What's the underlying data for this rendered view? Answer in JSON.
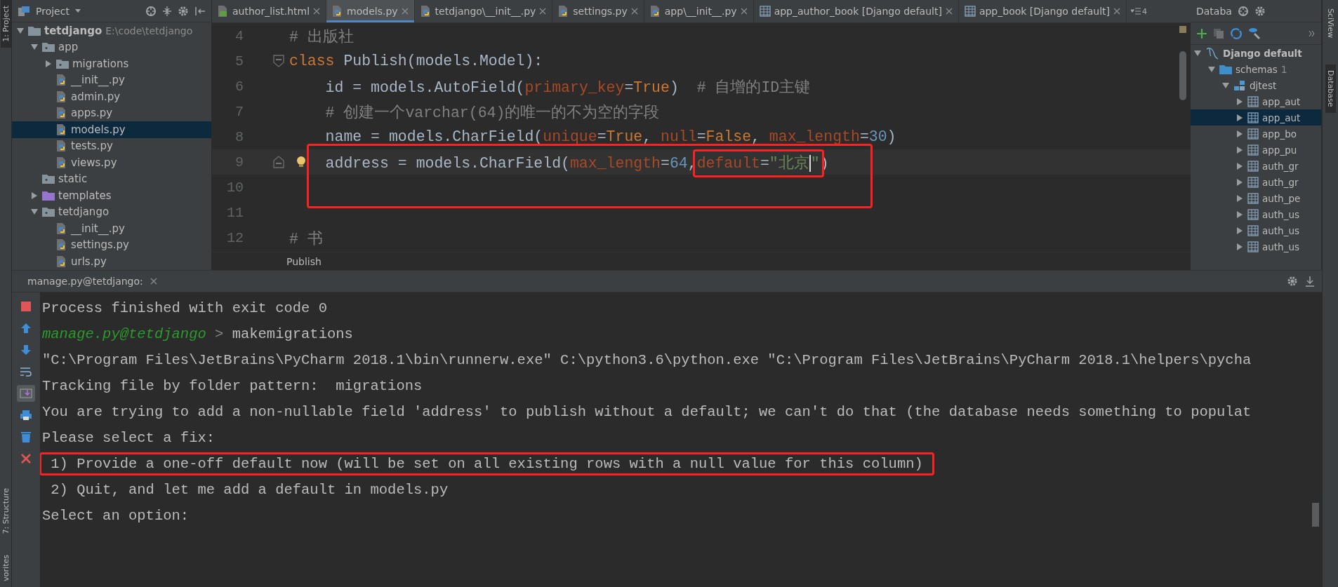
{
  "left_stripe": {
    "top": [
      {
        "label": "1: Project",
        "selected": true
      }
    ],
    "bottom": [
      {
        "label": "7: Structure",
        "selected": false
      },
      {
        "label": "vorites",
        "selected": false
      }
    ]
  },
  "right_stripe": [
    {
      "label": "SciView",
      "selected": false
    },
    {
      "label": "Database",
      "selected": true
    }
  ],
  "project_panel": {
    "title": "Project",
    "tree": [
      {
        "label": "tetdjango",
        "path": "E:\\code\\tetdjango",
        "kind": "folder",
        "expanded": true,
        "selected": false,
        "children": [
          {
            "label": "app",
            "kind": "package",
            "expanded": true,
            "selected": false,
            "children": [
              {
                "label": "migrations",
                "kind": "package",
                "expanded": false,
                "selected": false
              },
              {
                "label": "__init__.py",
                "kind": "python",
                "selected": false
              },
              {
                "label": "admin.py",
                "kind": "python",
                "selected": false
              },
              {
                "label": "apps.py",
                "kind": "python",
                "selected": false
              },
              {
                "label": "models.py",
                "kind": "python",
                "selected": true
              },
              {
                "label": "tests.py",
                "kind": "python",
                "selected": false
              },
              {
                "label": "views.py",
                "kind": "python",
                "selected": false
              }
            ]
          },
          {
            "label": "static",
            "kind": "package",
            "selected": false
          },
          {
            "label": "templates",
            "kind": "templates",
            "expanded": false,
            "selected": false
          },
          {
            "label": "tetdjango",
            "kind": "package",
            "expanded": true,
            "selected": false,
            "children": [
              {
                "label": "__init__.py",
                "kind": "python",
                "selected": false
              },
              {
                "label": "settings.py",
                "kind": "python",
                "selected": false
              },
              {
                "label": "urls.py",
                "kind": "python",
                "selected": false
              }
            ]
          }
        ]
      }
    ]
  },
  "editor_tabs": [
    {
      "label": "author_list.html",
      "kind": "html",
      "selected": false
    },
    {
      "label": "models.py",
      "kind": "python",
      "selected": true
    },
    {
      "label": "tetdjango\\__init__.py",
      "kind": "python",
      "selected": false
    },
    {
      "label": "settings.py",
      "kind": "python",
      "selected": false
    },
    {
      "label": "app\\__init__.py",
      "kind": "python",
      "selected": false
    },
    {
      "label": "app_author_book [Django default]",
      "kind": "table",
      "selected": false
    },
    {
      "label": "app_book [Django default]",
      "kind": "table",
      "selected": false
    }
  ],
  "tab_overflow_count": "4",
  "editor": {
    "breadcrumb": "Publish",
    "lines": [
      {
        "number": "4",
        "tokens": [
          {
            "text": "# 出版社",
            "kind": "comment"
          }
        ]
      },
      {
        "number": "5",
        "fold": {
          "kind": "start"
        },
        "tokens": [
          {
            "text": "class",
            "kind": "keyword"
          },
          {
            "text": " Publish(models.Model):",
            "kind": "plain"
          }
        ]
      },
      {
        "number": "6",
        "tokens": [
          {
            "text": "    id = models.AutoField(",
            "kind": "plain"
          },
          {
            "text": "primary_key",
            "kind": "param"
          },
          {
            "text": "=",
            "kind": "plain"
          },
          {
            "text": "True",
            "kind": "keyword"
          },
          {
            "text": ")  ",
            "kind": "plain"
          },
          {
            "text": "# 自增的ID主键",
            "kind": "comment"
          }
        ]
      },
      {
        "number": "7",
        "tokens": [
          {
            "text": "    # 创建一个varchar(64)的唯一的不为空的字段",
            "kind": "comment"
          }
        ]
      },
      {
        "number": "8",
        "tokens": [
          {
            "text": "    name = models.CharField(",
            "kind": "plain"
          },
          {
            "text": "unique",
            "kind": "param"
          },
          {
            "text": "=",
            "kind": "plain"
          },
          {
            "text": "True",
            "kind": "keyword"
          },
          {
            "text": ", ",
            "kind": "plain"
          },
          {
            "text": "null",
            "kind": "param"
          },
          {
            "text": "=",
            "kind": "plain"
          },
          {
            "text": "False",
            "kind": "keyword"
          },
          {
            "text": ", ",
            "kind": "plain"
          },
          {
            "text": "max_length",
            "kind": "param"
          },
          {
            "text": "=",
            "kind": "plain"
          },
          {
            "text": "30",
            "kind": "number"
          },
          {
            "text": ")",
            "kind": "plain"
          }
        ]
      },
      {
        "number": "9",
        "fold": {
          "kind": "end"
        },
        "bulb": true,
        "current": true,
        "boxed": true,
        "tokens": [
          {
            "text": "    address = models.CharField(",
            "kind": "plain"
          },
          {
            "text": "max_length",
            "kind": "param"
          },
          {
            "text": "=",
            "kind": "plain"
          },
          {
            "text": "64",
            "kind": "number"
          },
          {
            "text": ",",
            "kind": "plain"
          },
          {
            "kind": "group",
            "tokens": [
              {
                "text": "default",
                "kind": "param"
              },
              {
                "text": "=",
                "kind": "plain"
              },
              {
                "text": "\"北京",
                "kind": "string",
                "caret": true
              },
              {
                "text": "\"",
                "kind": "string"
              }
            ]
          },
          {
            "text": ")",
            "kind": "plain"
          }
        ]
      },
      {
        "number": "10",
        "boxed": true
      },
      {
        "number": "11"
      },
      {
        "number": "12",
        "tokens": [
          {
            "text": "# 书",
            "kind": "comment"
          }
        ]
      }
    ]
  },
  "database_panel": {
    "title": "Databa",
    "tree": [
      {
        "label": "Django default",
        "kind": "connection",
        "expanded": true,
        "selected": false,
        "children": [
          {
            "label": "schemas",
            "count": "1",
            "kind": "folder",
            "expanded": true,
            "selected": false,
            "children": [
              {
                "label": "djtest",
                "kind": "schema",
                "expanded": true,
                "selected": false,
                "children": [
                  {
                    "label": "app_aut",
                    "kind": "table",
                    "expanded": false,
                    "selected": false
                  },
                  {
                    "label": "app_aut",
                    "kind": "table",
                    "expanded": false,
                    "selected": true
                  },
                  {
                    "label": "app_bo",
                    "kind": "table",
                    "expanded": false,
                    "selected": false
                  },
                  {
                    "label": "app_pu",
                    "kind": "table",
                    "expanded": false,
                    "selected": false
                  },
                  {
                    "label": "auth_gr",
                    "kind": "table",
                    "expanded": false,
                    "selected": false
                  },
                  {
                    "label": "auth_gr",
                    "kind": "table",
                    "expanded": false,
                    "selected": false
                  },
                  {
                    "label": "auth_pe",
                    "kind": "table",
                    "expanded": false,
                    "selected": false
                  },
                  {
                    "label": "auth_us",
                    "kind": "table",
                    "expanded": false,
                    "selected": false
                  },
                  {
                    "label": "auth_us",
                    "kind": "table",
                    "expanded": false,
                    "selected": false
                  },
                  {
                    "label": "auth_us",
                    "kind": "table",
                    "expanded": false,
                    "selected": false
                  }
                ]
              }
            ]
          }
        ]
      }
    ]
  },
  "run_panel": {
    "title": "manage.py@tetdjango:",
    "autoscroll_on": true,
    "lines": [
      {
        "tokens": [
          {
            "text": "Process finished with exit code 0",
            "kind": "plain"
          }
        ]
      },
      {
        "tokens": [
          {
            "text": "manage.py@tetdjango",
            "kind": "prompt"
          },
          {
            "text": " > ",
            "kind": "separator"
          },
          {
            "text": "makemigrations",
            "kind": "plain"
          }
        ]
      },
      {
        "tokens": [
          {
            "text": "\"C:\\Program Files\\JetBrains\\PyCharm 2018.1\\bin\\runnerw.exe\" C:\\python3.6\\python.exe \"C:\\Program Files\\JetBrains\\PyCharm 2018.1\\helpers\\pycha",
            "kind": "plain"
          }
        ]
      },
      {
        "tokens": [
          {
            "text": "Tracking file by folder pattern:  migrations",
            "kind": "plain"
          }
        ]
      },
      {
        "tokens": [
          {
            "text": "You are trying to add a non-nullable field 'address' to publish without a default; we can't do that (the database needs something to populat",
            "kind": "plain"
          }
        ]
      },
      {
        "tokens": [
          {
            "text": "Please select a fix:",
            "kind": "plain"
          }
        ]
      },
      {
        "boxed": true,
        "tokens": [
          {
            "text": " 1) Provide a one-off default now (will be set on all existing rows with a null value for this column)",
            "kind": "plain"
          }
        ]
      },
      {
        "tokens": [
          {
            "text": " 2) Quit, and let me add a default in models.py",
            "kind": "plain"
          }
        ]
      },
      {
        "tokens": [
          {
            "text": "Select an option:",
            "kind": "plain"
          }
        ]
      }
    ]
  }
}
